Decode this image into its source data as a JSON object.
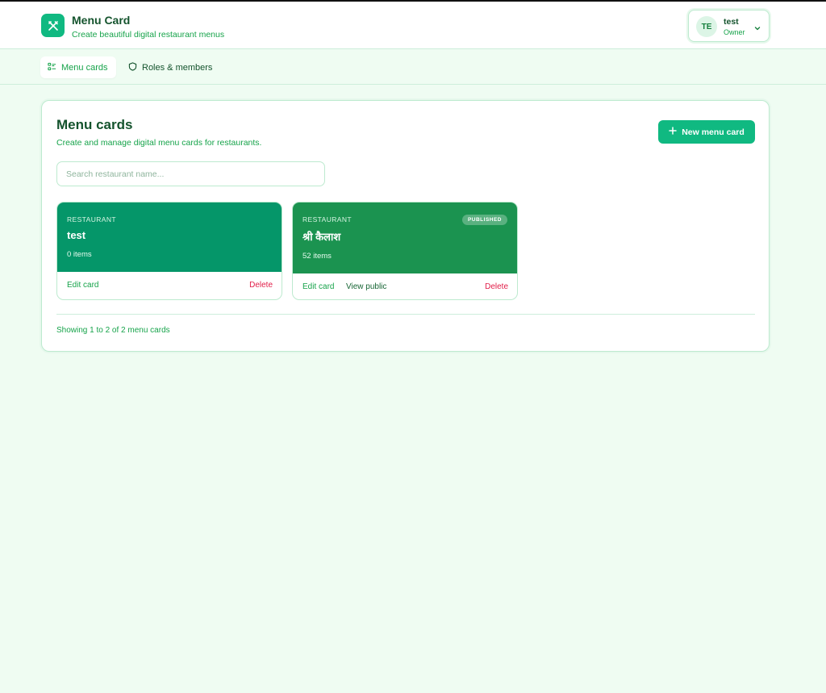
{
  "header": {
    "title": "Menu Card",
    "subtitle": "Create beautiful digital restaurant menus",
    "user": {
      "initials": "TE",
      "name": "test",
      "role": "Owner"
    }
  },
  "nav": {
    "tabs": [
      {
        "label": "Menu cards",
        "icon": "list-icon",
        "active": true
      },
      {
        "label": "Roles & members",
        "icon": "shield-icon",
        "active": false
      }
    ]
  },
  "main": {
    "title": "Menu cards",
    "subtitle": "Create and manage digital menu cards for restaurants.",
    "new_button_label": "New menu card",
    "search_placeholder": "Search restaurant name...",
    "cards": [
      {
        "label": "RESTAURANT",
        "name": "test",
        "items": "0 items",
        "published": false,
        "actions": {
          "edit": "Edit card",
          "delete": "Delete"
        }
      },
      {
        "label": "RESTAURANT",
        "name": "श्री कैलाश",
        "items": "52 items",
        "published": true,
        "badge": "PUBLISHED",
        "actions": {
          "edit": "Edit card",
          "view": "View public",
          "delete": "Delete"
        }
      }
    ],
    "footer": "Showing 1 to 2 of 2 menu cards"
  },
  "colors": {
    "accent": "#10b981",
    "background": "#effcf2",
    "danger": "#e11d48",
    "card_1": "#059669",
    "card_2": "#1b9350"
  }
}
